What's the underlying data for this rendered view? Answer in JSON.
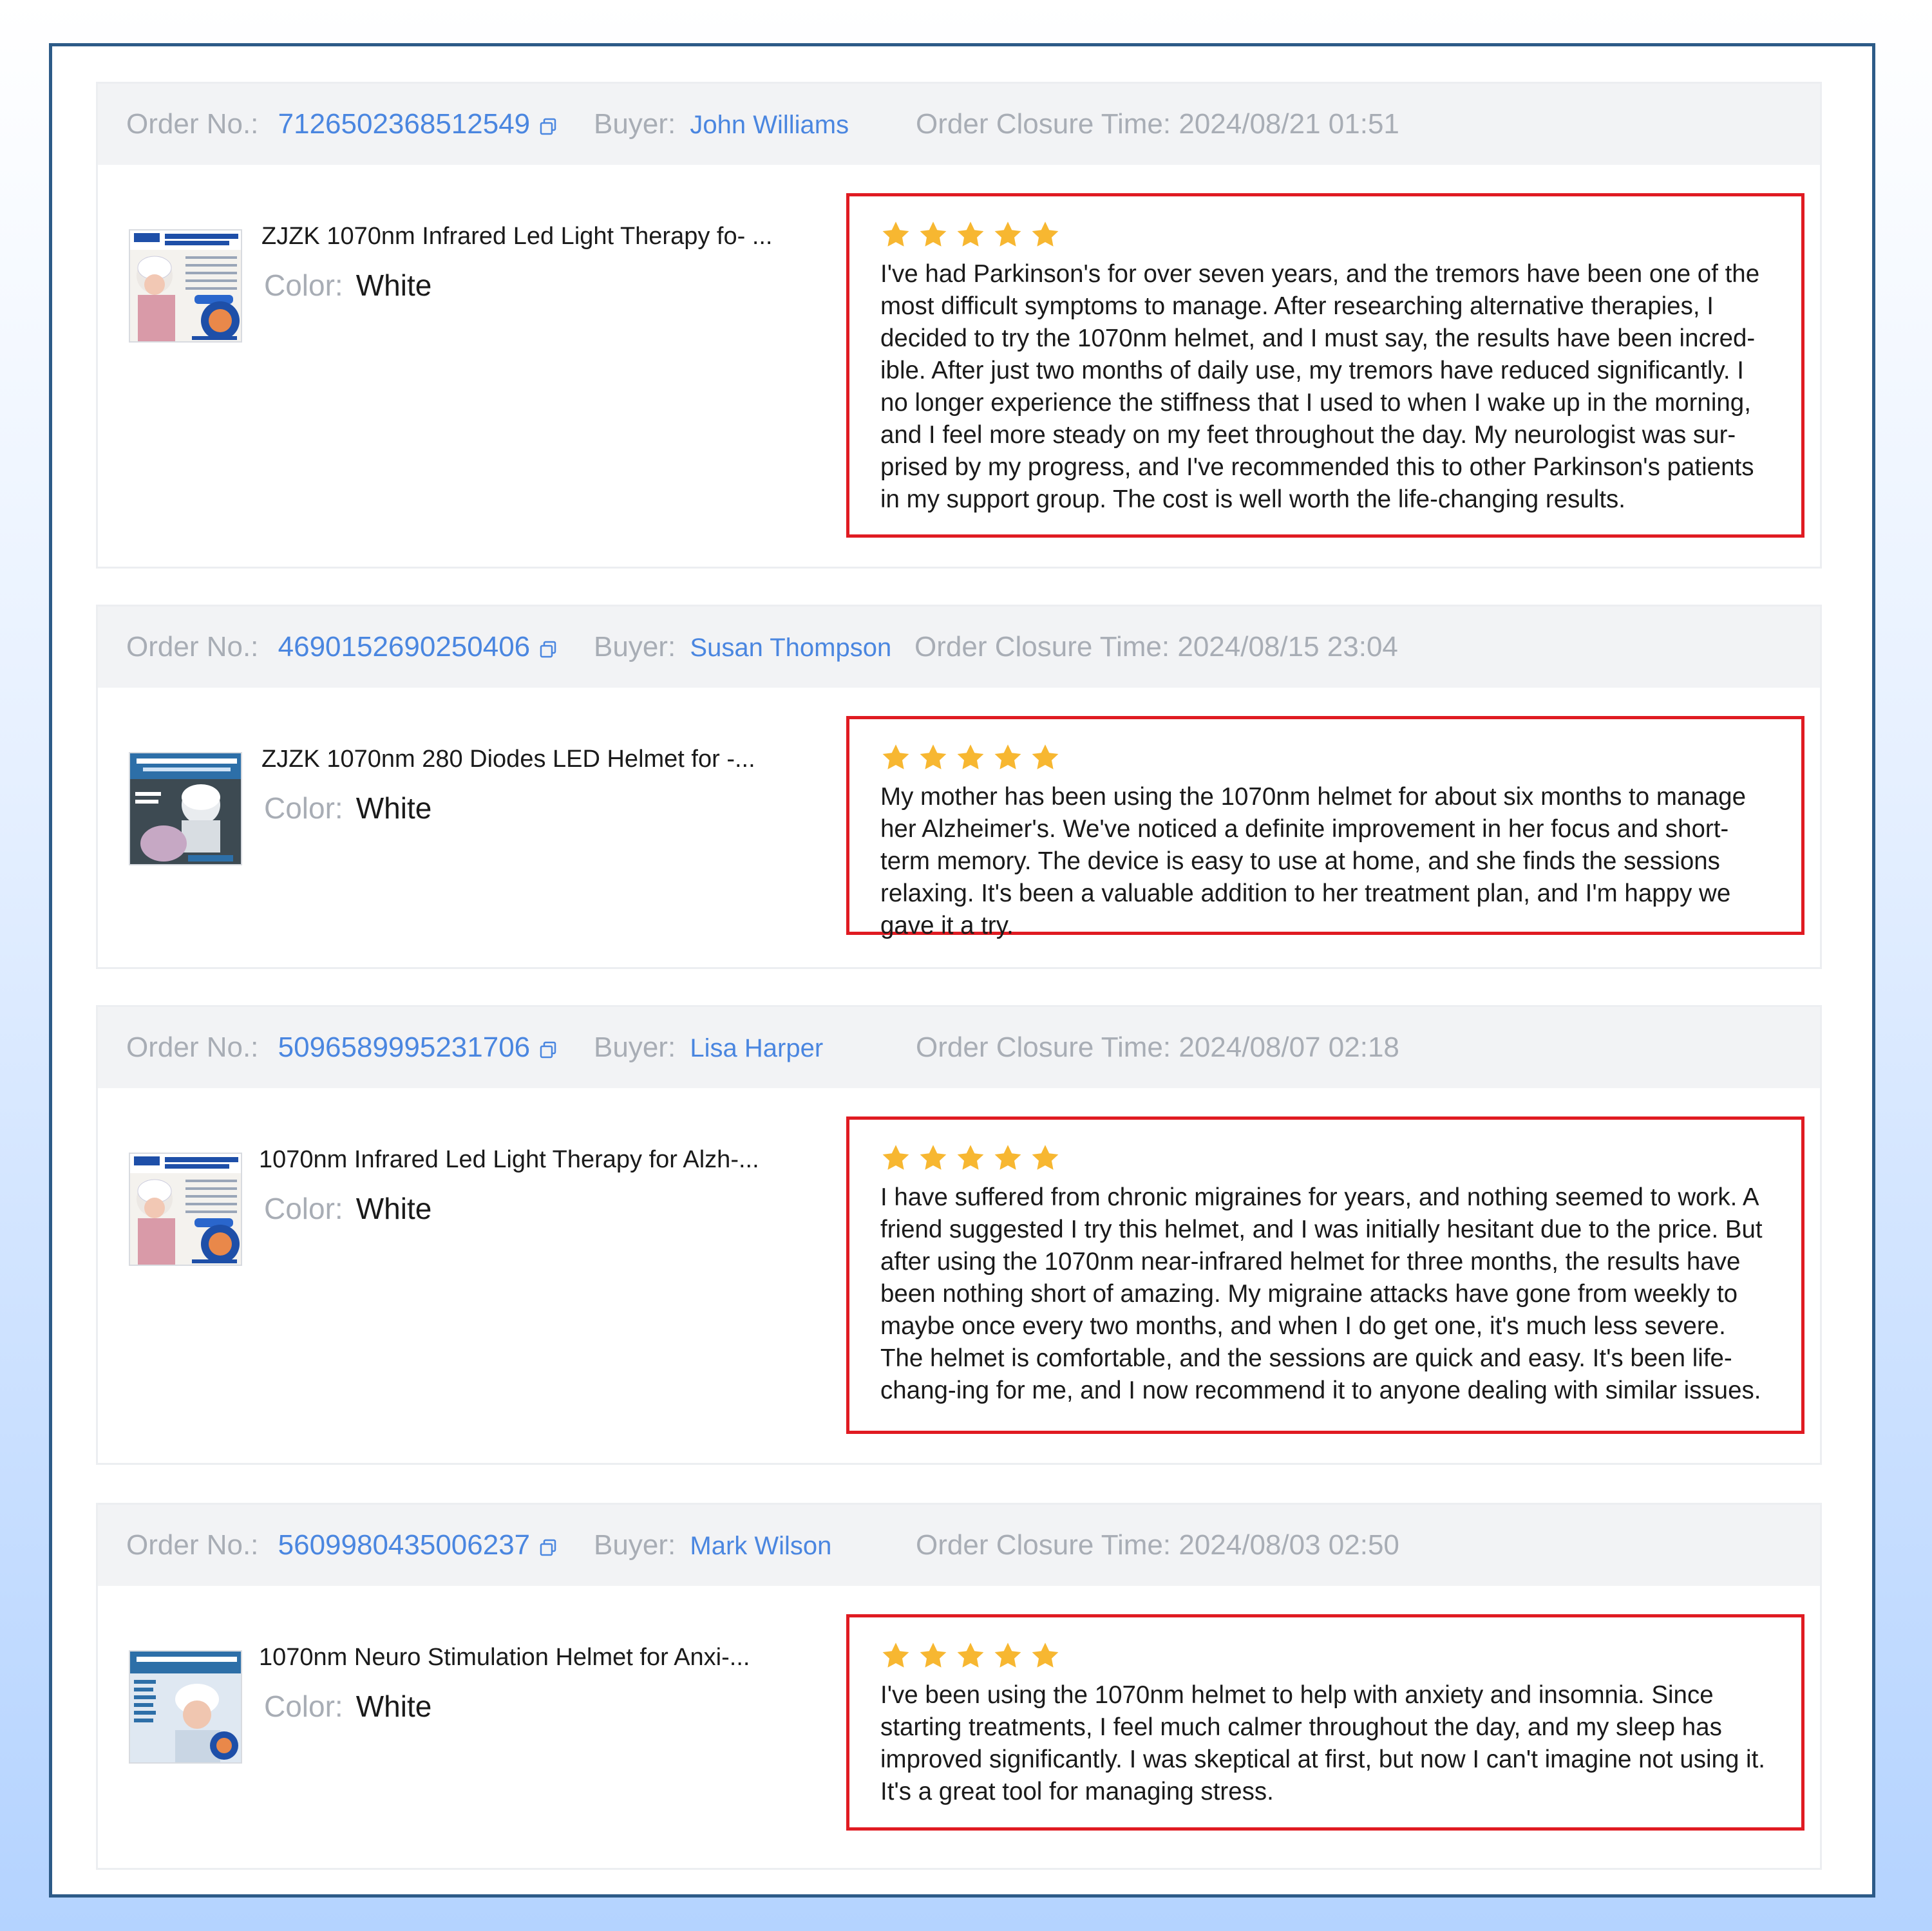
{
  "labels": {
    "order_no": "Order No.:",
    "buyer": "Buyer:",
    "closure_time": "Order Closure Time:",
    "color": "Color:"
  },
  "colors": {
    "accent_link": "#4a86e0",
    "review_border": "#e01b22",
    "star": "#f7b731",
    "frame_border": "#2d5b88"
  },
  "orders": [
    {
      "order_no": "7126502368512549",
      "buyer": "John Williams",
      "closure_time": "2024/08/21 01:51",
      "product_title": "ZJZK 1070nm Infrared Led Light Therapy fo- ...",
      "color": "White",
      "rating": 5,
      "review": "I've had Parkinson's for over seven years, and the tremors have been one of the most difficult symptoms to manage. After researching alternative therapies, I decided to try the 1070nm helmet, and I must say, the results have been incred-ible. After just two months of daily use, my tremors have reduced significantly. I no longer experience the stiffness that I used to when I wake up in the morning, and I feel more steady on my feet throughout the day. My neurologist was sur-prised by my progress, and I've recommended this to other Parkinson's patients in my support group. The cost is well worth the life-changing results."
    },
    {
      "order_no": "4690152690250406",
      "buyer": "Susan Thompson",
      "closure_time": "2024/08/15 23:04",
      "product_title": "ZJZK 1070nm 280 Diodes LED Helmet for -...",
      "color": "White",
      "rating": 5,
      "review": "My mother has been using the 1070nm helmet for about six months to manage her Alzheimer's. We've noticed a definite improvement in her focus and short-term memory. The device is easy to use at home, and she finds the sessions relaxing. It's been a valuable addition to her treatment plan, and I'm happy we gave it a try."
    },
    {
      "order_no": "5096589995231706",
      "buyer": "Lisa Harper",
      "closure_time": "2024/08/07 02:18",
      "product_title": "1070nm Infrared Led Light Therapy for Alzh-...",
      "color": "White",
      "rating": 5,
      "review": "I have suffered from chronic migraines for years, and nothing seemed to work. A friend suggested I try this helmet, and I was initially hesitant due to the price. But after using the 1070nm near-infrared helmet for three months, the results have been nothing short of amazing. My migraine attacks have gone from weekly to maybe once every two months, and when I do get one, it's much less severe. The helmet is comfortable, and the sessions are quick and easy. It's been life-chang-ing for me, and I now recommend it to anyone dealing with similar issues."
    },
    {
      "order_no": "5609980435006237",
      "buyer": "Mark Wilson",
      "closure_time": "2024/08/03 02:50",
      "product_title": "1070nm Neuro Stimulation Helmet for Anxi-...",
      "color": "White",
      "rating": 5,
      "review": "I've been using the 1070nm helmet to help with anxiety and insomnia. Since starting treatments, I feel much calmer throughout the day, and my sleep has improved significantly. I was skeptical at first, but now I can't imagine not using it. It's a great tool for managing stress."
    }
  ]
}
